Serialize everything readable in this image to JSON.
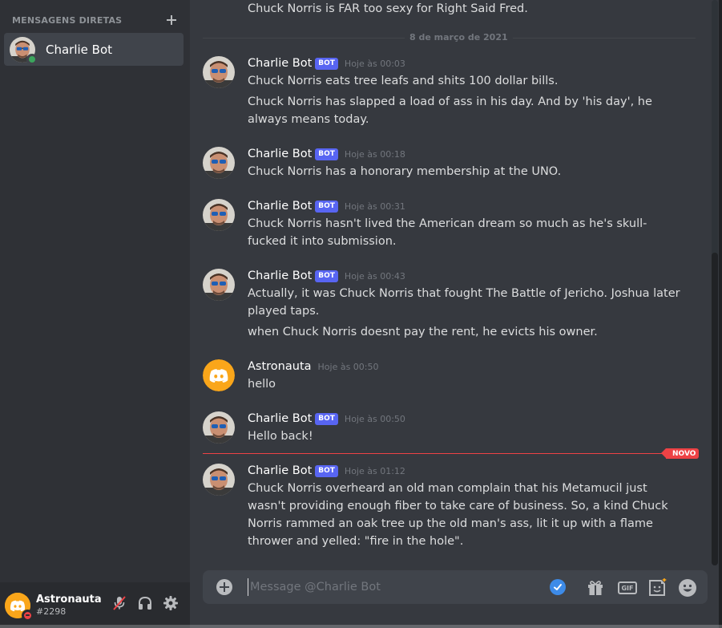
{
  "sidebar": {
    "header": "MENSAGENS DIRETAS",
    "dm_items": [
      {
        "name": "Charlie Bot",
        "status": "online"
      }
    ]
  },
  "user_panel": {
    "username": "Astronauta",
    "tag": "#2298",
    "status": "dnd"
  },
  "messages": {
    "top_line": "Chuck Norris is FAR too sexy for Right Said Fred.",
    "date_divider": "8 de março de 2021",
    "groups": [
      {
        "author": "Charlie Bot",
        "bot_tag": "BOT",
        "timestamp": "Hoje às 00:03",
        "lines": [
          "Chuck Norris eats tree leafs and shits 100 dollar bills.",
          "Chuck Norris has slapped a load of ass in his day. And by 'his day', he always means today."
        ]
      },
      {
        "author": "Charlie Bot",
        "bot_tag": "BOT",
        "timestamp": "Hoje às 00:18",
        "lines": [
          "Chuck Norris has a honorary membership at the UNO."
        ]
      },
      {
        "author": "Charlie Bot",
        "bot_tag": "BOT",
        "timestamp": "Hoje às 00:31",
        "lines": [
          "Chuck Norris hasn't lived the American dream so much as he's skull-fucked it into submission."
        ]
      },
      {
        "author": "Charlie Bot",
        "bot_tag": "BOT",
        "timestamp": "Hoje às 00:43",
        "lines": [
          "Actually, it was Chuck Norris that fought The Battle of Jericho. Joshua later played taps.",
          "when Chuck Norris doesnt pay the rent, he evicts his owner."
        ]
      },
      {
        "author": "Astronauta",
        "bot_tag": "",
        "timestamp": "Hoje às 00:50",
        "lines": [
          "hello"
        ]
      },
      {
        "author": "Charlie Bot",
        "bot_tag": "BOT",
        "timestamp": "Hoje às 00:50",
        "lines": [
          "Hello back!"
        ]
      },
      {
        "author": "Charlie Bot",
        "bot_tag": "BOT",
        "timestamp": "Hoje às 01:12",
        "lines": [
          "Chuck Norris overheard an old man complain that his Metamucil just wasn't providing enough fiber to take care of business. So, a kind Chuck Norris rammed an oak tree up the old man's ass, lit it up with a flame thrower and yelled: \"fire in the hole\"."
        ]
      }
    ],
    "new_badge": "NOVO"
  },
  "composer": {
    "placeholder": "Message @Charlie Bot",
    "gif_label": "GIF"
  },
  "colors": {
    "bot_tag": "#5865f2",
    "new_marker": "#ed4245",
    "online": "#3ba55d",
    "dnd": "#ed4245",
    "user_avatar": "#faa61a"
  },
  "icons": [
    "plus-icon",
    "mute-icon",
    "headphones-icon",
    "gear-icon",
    "add-attachment-icon",
    "check-icon",
    "gift-icon",
    "gif-icon",
    "sticker-icon",
    "emoji-icon"
  ]
}
